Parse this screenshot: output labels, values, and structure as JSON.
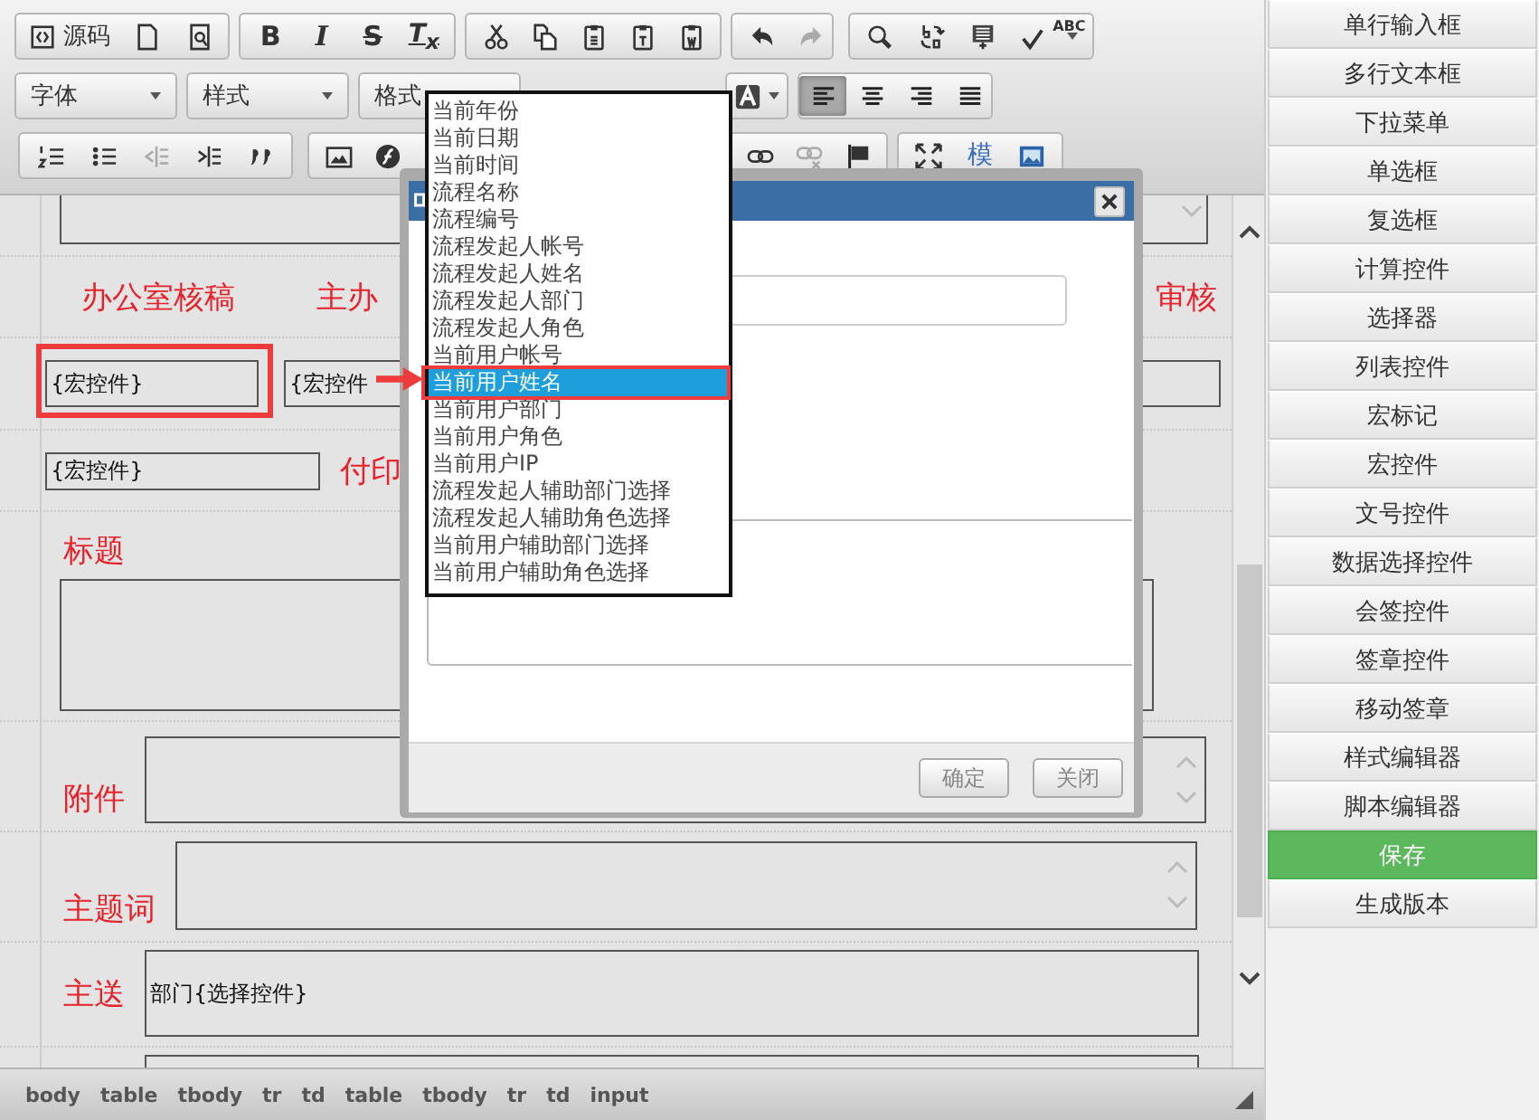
{
  "toolbar": {
    "rows": [
      {
        "groups": [
          {
            "buttons": [
              {
                "kind": "source",
                "label": "源码",
                "disabled": false,
                "active": false
              },
              {
                "kind": "newpage",
                "disabled": false,
                "active": false
              },
              {
                "kind": "preview",
                "disabled": false,
                "active": false
              }
            ]
          },
          {
            "buttons": [
              {
                "kind": "bold",
                "label": "B",
                "disabled": false,
                "active": false
              },
              {
                "kind": "italic",
                "label": "I",
                "disabled": false,
                "active": false
              },
              {
                "kind": "strike",
                "label": "S",
                "disabled": false,
                "active": false
              },
              {
                "kind": "removeformat",
                "label": "T$_{x}$",
                "disabled": false,
                "active": false
              }
            ]
          },
          {
            "buttons": [
              {
                "kind": "cut",
                "disabled": false,
                "active": false
              },
              {
                "kind": "copy",
                "disabled": false,
                "active": false
              },
              {
                "kind": "paste",
                "disabled": false,
                "active": false
              },
              {
                "kind": "pastetext",
                "disabled": false,
                "active": false
              },
              {
                "kind": "pasteword",
                "disabled": false,
                "active": false
              }
            ]
          },
          {
            "buttons": [
              {
                "kind": "undo",
                "disabled": false,
                "active": false
              },
              {
                "kind": "redo",
                "disabled": true,
                "active": false
              }
            ]
          },
          {
            "buttons": [
              {
                "kind": "find",
                "disabled": false,
                "active": false
              },
              {
                "kind": "replace",
                "disabled": false,
                "active": false
              },
              {
                "kind": "selectall",
                "disabled": false,
                "active": false
              },
              {
                "kind": "spellcheck",
                "label": "ABC",
                "disabled": false,
                "active": false
              }
            ]
          }
        ]
      },
      {
        "groups": [
          {
            "buttons": [
              {
                "kind": "dropdown",
                "label": "字体",
                "disabled": false,
                "active": false
              }
            ]
          },
          {
            "buttons": [
              {
                "kind": "dropdown",
                "label": "样式",
                "disabled": false,
                "active": false
              }
            ]
          },
          {
            "buttons": [
              {
                "kind": "dropdown",
                "label": "格式",
                "disabled": false,
                "active": false
              }
            ]
          },
          {
            "buttons": [
              {
                "kind": "bgcolor",
                "disabled": false,
                "active": false
              }
            ]
          },
          {
            "buttons": [
              {
                "kind": "alignleft",
                "disabled": false,
                "active": true
              },
              {
                "kind": "aligncenter",
                "disabled": false,
                "active": false
              },
              {
                "kind": "alignright",
                "disabled": false,
                "active": false
              },
              {
                "kind": "justify",
                "disabled": false,
                "active": false
              }
            ]
          }
        ]
      },
      {
        "groups": [
          {
            "buttons": [
              {
                "kind": "ol",
                "disabled": false,
                "active": false
              },
              {
                "kind": "ul",
                "disabled": false,
                "active": false
              },
              {
                "kind": "outdent",
                "disabled": true,
                "active": false
              },
              {
                "kind": "indent",
                "disabled": false,
                "active": false
              },
              {
                "kind": "blockquote",
                "disabled": false,
                "active": false
              }
            ]
          },
          {
            "buttons": [
              {
                "kind": "image",
                "disabled": false,
                "active": false
              },
              {
                "kind": "flash",
                "disabled": false,
                "active": false
              },
              {
                "kind": "link",
                "disabled": false,
                "active": false
              },
              {
                "kind": "unlink",
                "disabled": true,
                "active": false
              },
              {
                "kind": "anchor",
                "disabled": false,
                "active": false
              }
            ]
          },
          {
            "buttons": [
              {
                "kind": "maximize",
                "disabled": false,
                "active": false
              },
              {
                "kind": "template",
                "label": "模",
                "disabled": false,
                "active": false
              },
              {
                "kind": "picture",
                "disabled": false,
                "active": false
              }
            ]
          }
        ]
      }
    ]
  },
  "form_rows": [
    {
      "kind": "textarea"
    },
    {
      "kind": "headings",
      "labels": [
        "办公室核稿",
        "主办",
        "审核"
      ]
    },
    {
      "kind": "fields",
      "values": [
        "{宏控件}",
        "{宏控件"
      ]
    },
    {
      "kind": "field_label",
      "value": "{宏控件}",
      "label": "付印"
    },
    {
      "kind": "label_above",
      "label": "标题"
    },
    {
      "kind": "label_left",
      "label": "附件"
    },
    {
      "kind": "label_left",
      "label": "主题词"
    },
    {
      "kind": "label_input",
      "label": "主送",
      "value": "部门{选择控件}"
    },
    {
      "kind": "partial"
    }
  ],
  "status_bar": {
    "path": [
      "body",
      "table",
      "tbody",
      "tr",
      "td",
      "table",
      "tbody",
      "tr",
      "td",
      "input"
    ]
  },
  "dialog": {
    "buttons": [
      "确定",
      "关闭"
    ]
  },
  "dropdown": {
    "items": [
      {
        "label": "当前年份",
        "selected": false
      },
      {
        "label": "当前日期",
        "selected": false
      },
      {
        "label": "当前时间",
        "selected": false
      },
      {
        "label": "流程名称",
        "selected": false
      },
      {
        "label": "流程编号",
        "selected": false
      },
      {
        "label": "流程发起人帐号",
        "selected": false
      },
      {
        "label": "流程发起人姓名",
        "selected": false
      },
      {
        "label": "流程发起人部门",
        "selected": false
      },
      {
        "label": "流程发起人角色",
        "selected": false
      },
      {
        "label": "当前用户帐号",
        "selected": false
      },
      {
        "label": "当前用户姓名",
        "selected": true
      },
      {
        "label": "当前用户部门",
        "selected": false
      },
      {
        "label": "当前用户角色",
        "selected": false
      },
      {
        "label": "当前用户IP",
        "selected": false
      },
      {
        "label": "流程发起人辅助部门选择",
        "selected": false
      },
      {
        "label": "流程发起人辅助角色选择",
        "selected": false
      },
      {
        "label": "当前用户辅助部门选择",
        "selected": false
      },
      {
        "label": "当前用户辅助角色选择",
        "selected": false
      }
    ]
  },
  "sidebar": {
    "items": [
      {
        "label": "单行输入框",
        "kind": "normal"
      },
      {
        "label": "多行文本框",
        "kind": "normal"
      },
      {
        "label": "下拉菜单",
        "kind": "normal"
      },
      {
        "label": "单选框",
        "kind": "normal"
      },
      {
        "label": "复选框",
        "kind": "normal"
      },
      {
        "label": "计算控件",
        "kind": "normal"
      },
      {
        "label": "选择器",
        "kind": "normal"
      },
      {
        "label": "列表控件",
        "kind": "normal"
      },
      {
        "label": "宏标记",
        "kind": "normal"
      },
      {
        "label": "宏控件",
        "kind": "normal"
      },
      {
        "label": "文号控件",
        "kind": "normal"
      },
      {
        "label": "数据选择控件",
        "kind": "normal"
      },
      {
        "label": "会签控件",
        "kind": "normal"
      },
      {
        "label": "签章控件",
        "kind": "normal"
      },
      {
        "label": "移动签章",
        "kind": "normal"
      },
      {
        "label": "样式编辑器",
        "kind": "normal"
      },
      {
        "label": "脚本编辑器",
        "kind": "normal"
      },
      {
        "label": "保存",
        "kind": "primary"
      },
      {
        "label": "生成版本",
        "kind": "normal"
      }
    ]
  }
}
